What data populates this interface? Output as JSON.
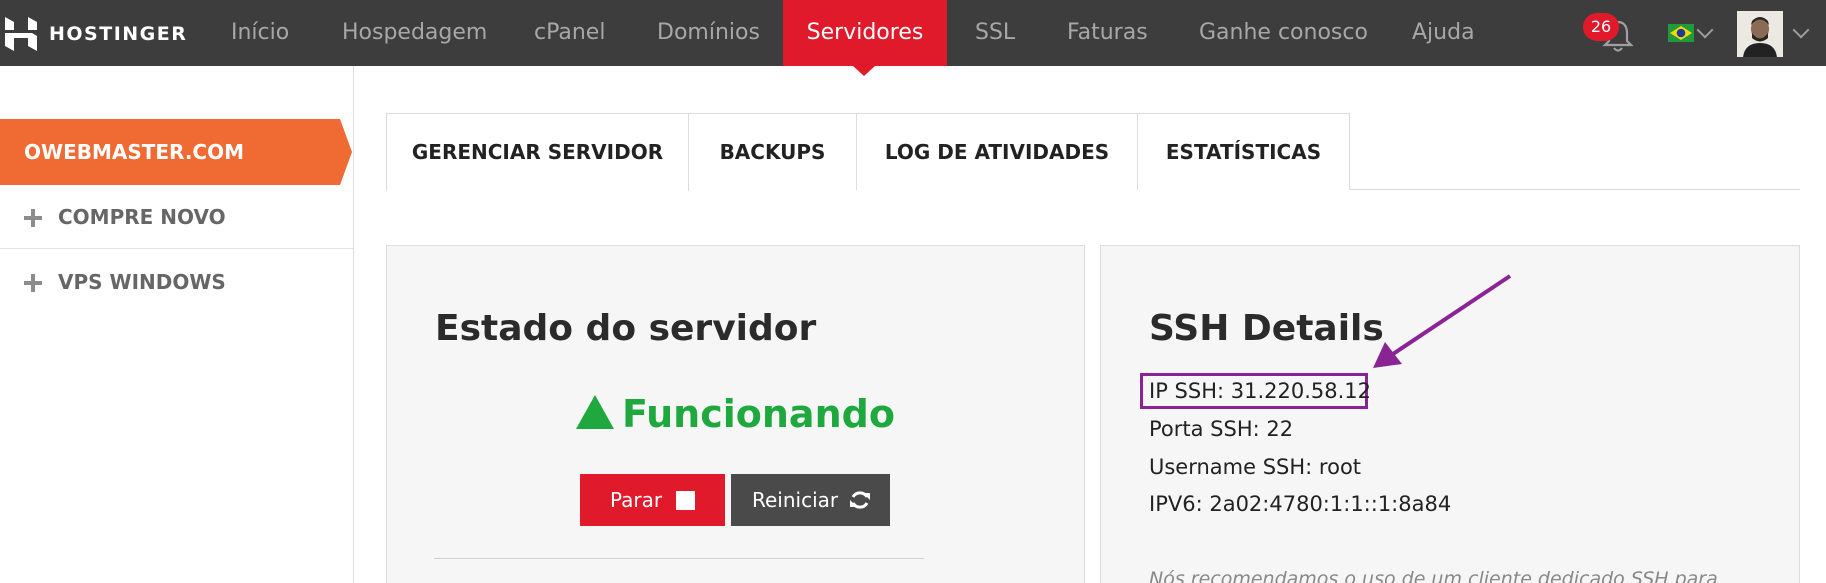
{
  "brand": {
    "name": "HOSTINGER"
  },
  "nav": {
    "items": [
      "Início",
      "Hospedagem",
      "cPanel",
      "Domínios",
      "Servidores",
      "SSL",
      "Faturas",
      "Ganhe conosco",
      "Ajuda"
    ],
    "active": "Servidores",
    "notifications_count": "26",
    "language_icon": "brazil-flag-icon",
    "accent_color": "#e0192b"
  },
  "sidebar": {
    "active_item": "OWEBMASTER.COM",
    "items": [
      "COMPRE NOVO",
      "VPS WINDOWS"
    ],
    "accent_color": "#f06a34"
  },
  "tabs": [
    "GERENCIAR SERVIDOR",
    "BACKUPS",
    "LOG DE ATIVIDADES",
    "ESTATÍSTICAS"
  ],
  "server_status": {
    "title": "Estado do servidor",
    "status": "Funcionando",
    "status_color": "#1ea83e",
    "stop_label": "Parar",
    "restart_label": "Reiniciar"
  },
  "ssh": {
    "title": "SSH Details",
    "ip": "IP SSH: 31.220.58.12",
    "port": "Porta SSH: 22",
    "username": "Username SSH: root",
    "ipv6": "IPV6: 2a02:4780:1:1::1:8a84",
    "note": "Nós recomendamos o uso de um cliente dedicado SSH para",
    "highlight_color": "#8a2494"
  }
}
